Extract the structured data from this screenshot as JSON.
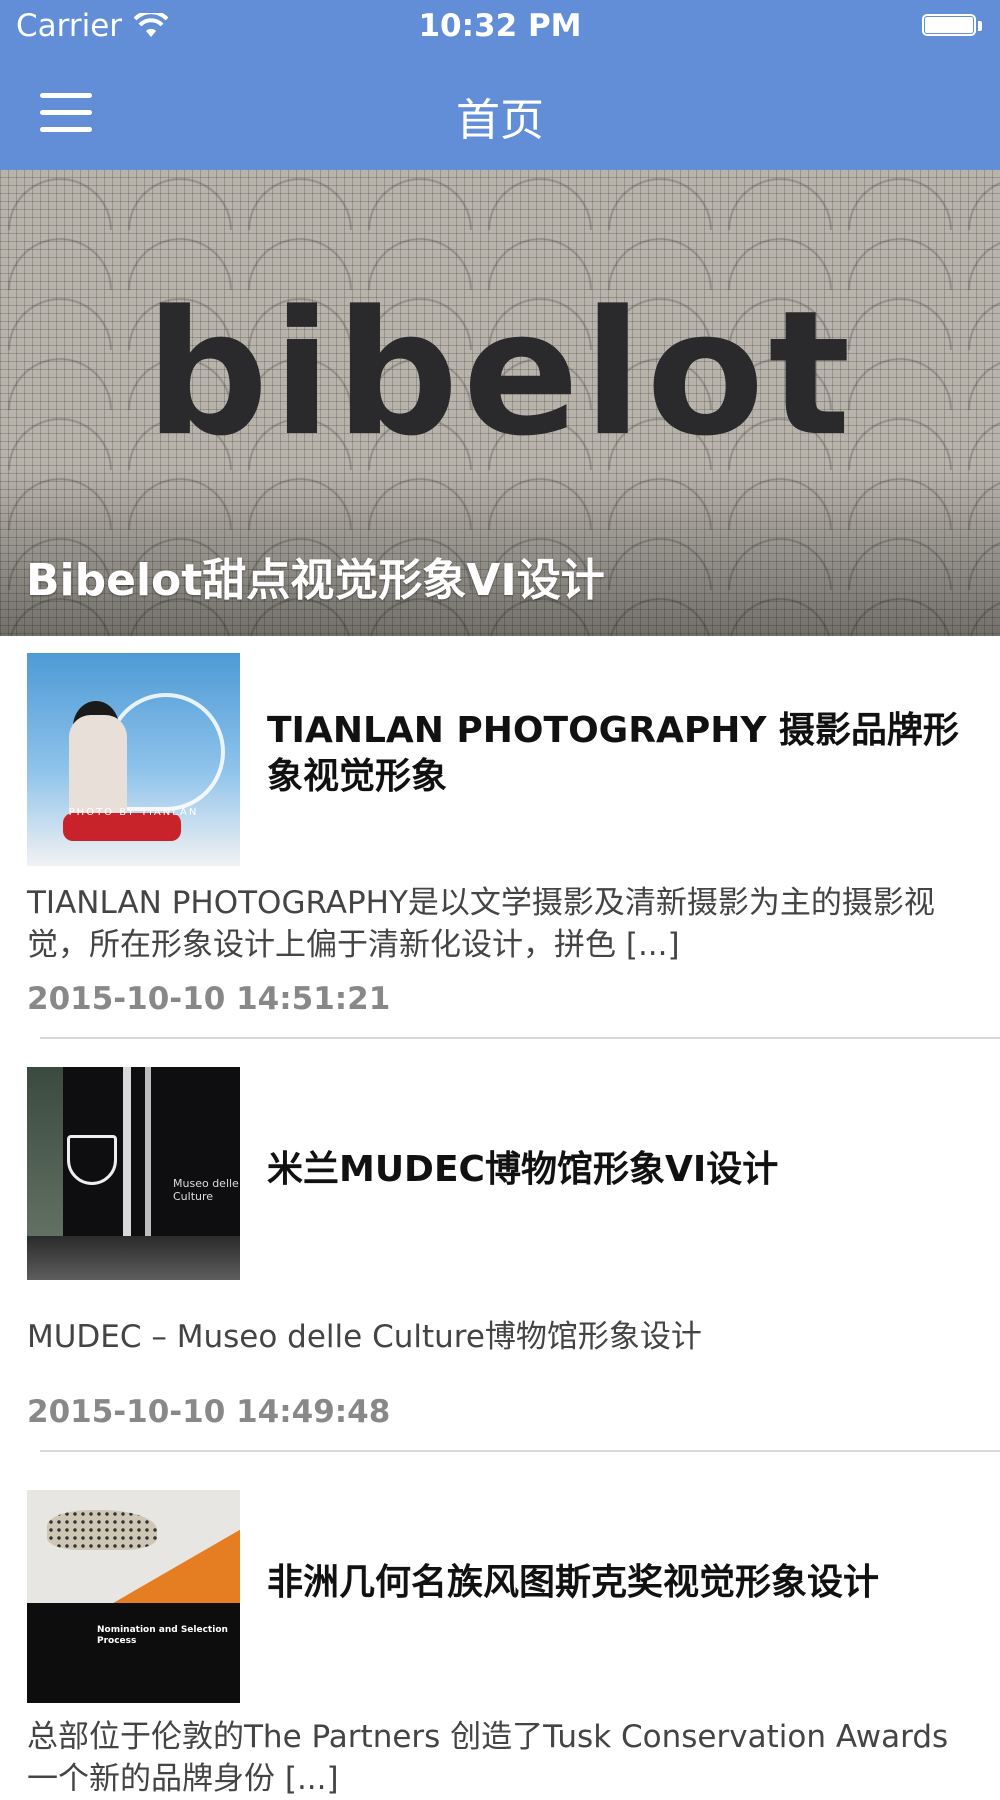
{
  "status_bar": {
    "carrier": "Carrier",
    "time": "10:32 PM",
    "battery_level": 1.0
  },
  "nav": {
    "title": "首页",
    "menu_icon": "hamburger-menu-icon"
  },
  "banner": {
    "logo_text": "bibelot",
    "caption": "Bibelot甜点视觉形象VI设计"
  },
  "articles": [
    {
      "title": "TIANLAN PHOTOGRAPHY 摄影品牌形象视觉形象",
      "summary": "TIANLAN PHOTOGRAPHY是以文学摄影及清新摄影为主的摄影视觉，所在形象设计上偏于清新化设计，拼色 [...]",
      "date": "2015-10-10 14:51:21",
      "thumb_text": "PHOTO BY TIANLAN"
    },
    {
      "title": "米兰MUDEC博物馆形象VI设计",
      "summary": "MUDEC – Museo delle Culture博物馆形象设计",
      "date": "2015-10-10 14:49:48",
      "thumb_text": "Museo delle Culture"
    },
    {
      "title": "非洲几何名族风图斯克奖视觉形象设计",
      "summary": "总部位于伦敦的The Partners 创造了Tusk Conservation Awards一个新的品牌身份 [...]",
      "date": "",
      "thumb_text": "Nomination and Selection Process"
    }
  ]
}
